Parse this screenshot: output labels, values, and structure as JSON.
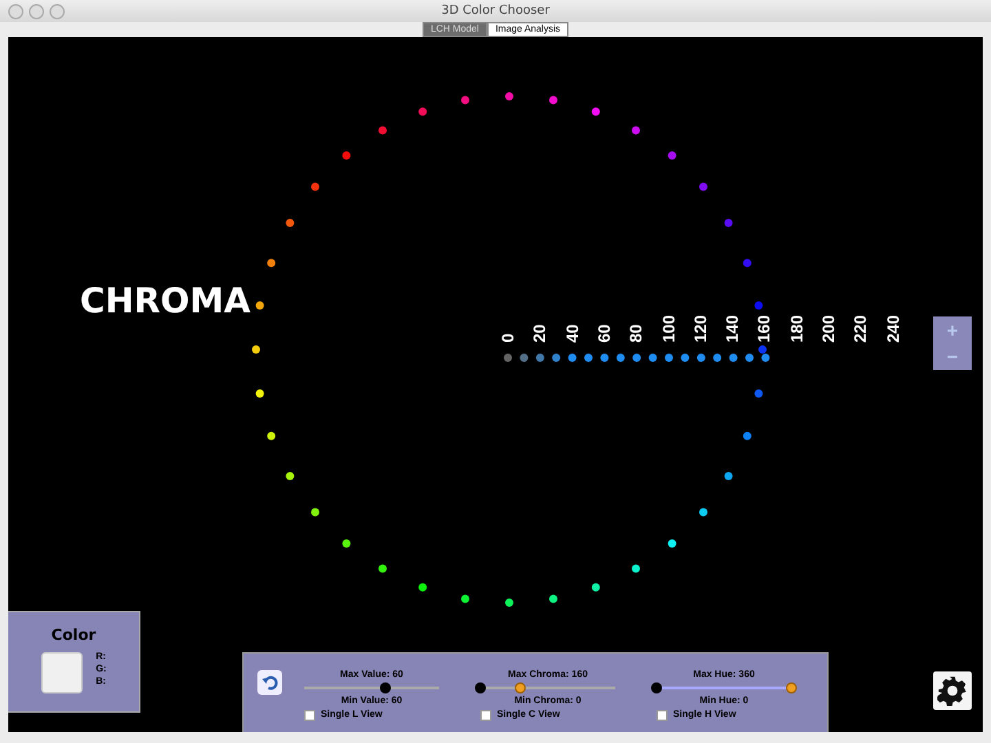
{
  "window": {
    "title": "3D Color Chooser"
  },
  "tabs": [
    {
      "label": "LCH Model",
      "selected": true
    },
    {
      "label": "Image Analysis",
      "selected": false
    }
  ],
  "canvas": {
    "axis_title": "CHROMA",
    "axis_labels": [
      "0",
      "20",
      "40",
      "60",
      "80",
      "100",
      "120",
      "140",
      "160",
      "180",
      "200",
      "220",
      "240"
    ]
  },
  "zoom": {
    "plus": "+",
    "minus": "−"
  },
  "color_panel": {
    "title": "Color",
    "channels": [
      "R:",
      "G:",
      "B:"
    ]
  },
  "controls": {
    "groups": [
      {
        "max_label": "Max Value: 60",
        "min_label": "Min Value: 60",
        "max_thumb": {
          "level": 0.6,
          "highlighted": false
        },
        "min_thumb": {
          "level": 0.6,
          "highlighted": false
        },
        "checkbox": {
          "label": "Single L View",
          "checked": false
        }
      },
      {
        "max_label": "Max Chroma: 160",
        "min_label": "Min Chroma: 0",
        "max_thumb": {
          "level": 0.3,
          "highlighted": true
        },
        "min_thumb": {
          "level": 0,
          "highlighted": false
        },
        "checkbox": {
          "label": "Single C View",
          "checked": false
        }
      },
      {
        "max_label": "Max Hue: 360",
        "min_label": "Min Hue: 0",
        "max_thumb": {
          "level": 1,
          "highlighted": true
        },
        "min_thumb": {
          "level": 0,
          "highlighted": false
        },
        "checkbox": {
          "label": "Single H View",
          "checked": false
        }
      }
    ]
  }
}
